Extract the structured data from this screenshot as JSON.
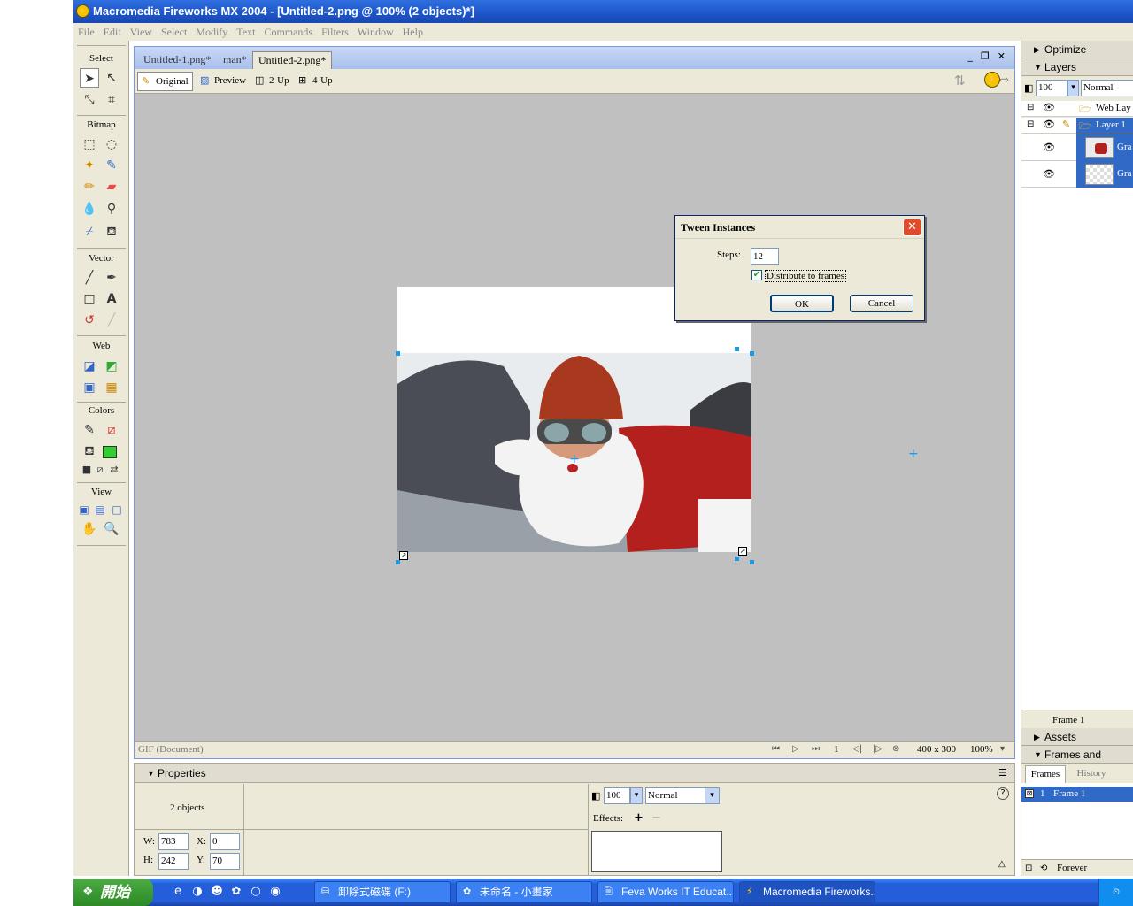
{
  "window": {
    "title": "Macromedia Fireworks MX 2004 - [Untitled-2.png @ 100% (2 objects)*]"
  },
  "menu": [
    "File",
    "Edit",
    "View",
    "Select",
    "Modify",
    "Text",
    "Commands",
    "Filters",
    "Window",
    "Help"
  ],
  "toolbar": {
    "select": "Select",
    "bitmap": "Bitmap",
    "vector": "Vector",
    "web": "Web",
    "colors": "Colors",
    "view": "View"
  },
  "doc_tabs": [
    "Untitled-1.png*",
    "man*",
    "Untitled-2.png*"
  ],
  "view_modes": [
    "Original",
    "Preview",
    "2-Up",
    "4-Up"
  ],
  "doc_status": {
    "format": "GIF (Document)",
    "frame": "1",
    "size": "400 x 300",
    "zoom": "100%"
  },
  "dialog": {
    "title": "Tween Instances",
    "steps_label": "Steps:",
    "steps_value": "12",
    "distribute_label": "Distribute to frames",
    "distribute_checked": true,
    "ok": "OK",
    "cancel": "Cancel"
  },
  "properties": {
    "header": "Properties",
    "selection": "2 objects",
    "w_label": "W:",
    "w": "783",
    "h_label": "H:",
    "h": "242",
    "x_label": "X:",
    "x": "0",
    "y_label": "Y:",
    "y": "70",
    "opacity": "100",
    "blend": "Normal",
    "effects_label": "Effects:"
  },
  "panels": {
    "optimize": "Optimize",
    "layers": "Layers",
    "opacity": "100",
    "blend": "Normal",
    "layer_rows": [
      "Web Lay",
      "Layer 1",
      "Gra",
      "Gra"
    ],
    "frame_label": "Frame 1",
    "assets": "Assets",
    "frames_history": "Frames and History",
    "tab_frames": "Frames",
    "tab_history": "History",
    "frame_row_num": "1",
    "frame_row_name": "Frame 1",
    "loop": "Forever"
  },
  "taskbar": {
    "start": "開始",
    "buttons": [
      "卸除式磁碟 (F:)",
      "未命名 - 小畫家",
      "Feva Works IT Educat...",
      "Macromedia Fireworks..."
    ]
  },
  "colors": {
    "accent": "#316ac5",
    "canvas_bg": "#c0c0c0",
    "fill_swatch": "#33cc33"
  }
}
